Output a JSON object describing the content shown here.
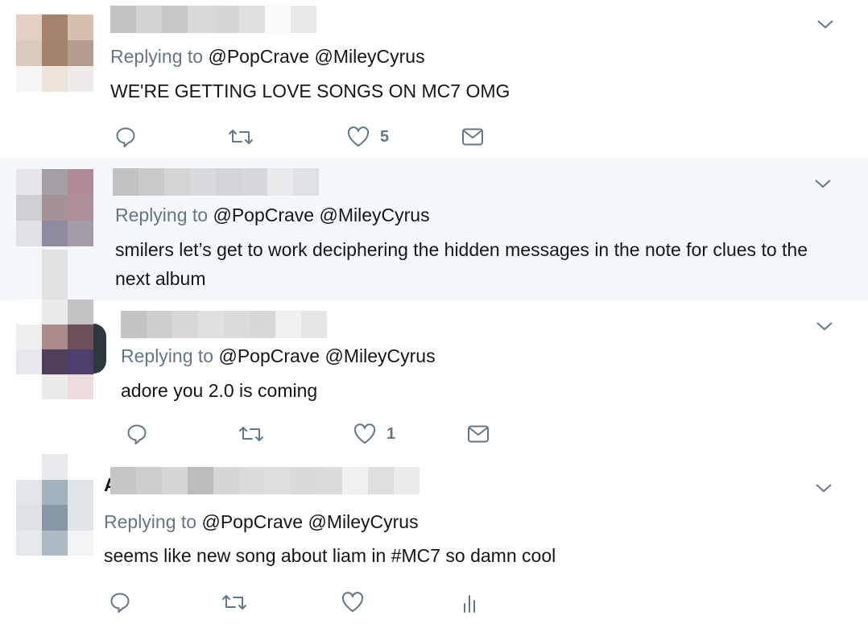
{
  "colors": {
    "link": "#657786",
    "text": "#14171a",
    "highlight_bg": "#f5f8fa",
    "icon": "#657786"
  },
  "tweets": [
    {
      "author_initial": "",
      "reply_prefix": "Replying to",
      "mentions": [
        "@PopCrave",
        "@MileyCyrus"
      ],
      "text": "WE'RE GETTING LOVE SONGS ON MC7 OMG",
      "actions": {
        "reply_icon": "reply-icon",
        "retweet_icon": "retweet-icon",
        "like_icon": "heart-icon",
        "like_count": "5",
        "dm_icon": "envelope-icon"
      }
    },
    {
      "author_initial": "",
      "reply_prefix": "Replying to",
      "mentions": [
        "@PopCrave",
        "@MileyCyrus"
      ],
      "text": "smilers let’s get to work deciphering the hidden messages in the note for clues to the next album"
    },
    {
      "author_initial": "",
      "reply_prefix": "Replying to",
      "mentions": [
        "@PopCrave",
        "@MileyCyrus"
      ],
      "text": "adore you 2.0 is coming",
      "actions": {
        "reply_icon": "reply-icon",
        "retweet_icon": "retweet-icon",
        "like_icon": "heart-icon",
        "like_count": "1",
        "dm_icon": "envelope-icon"
      }
    },
    {
      "author_initial": "A",
      "reply_prefix": "Replying to",
      "mentions": [
        "@PopCrave",
        "@MileyCyrus"
      ],
      "text": "seems like new song about liam in #MC7 so damn cool",
      "actions": {
        "reply_icon": "reply-icon",
        "retweet_icon": "retweet-icon",
        "like_icon": "heart-icon",
        "like_count": "",
        "analytics_icon": "analytics-icon"
      }
    }
  ]
}
